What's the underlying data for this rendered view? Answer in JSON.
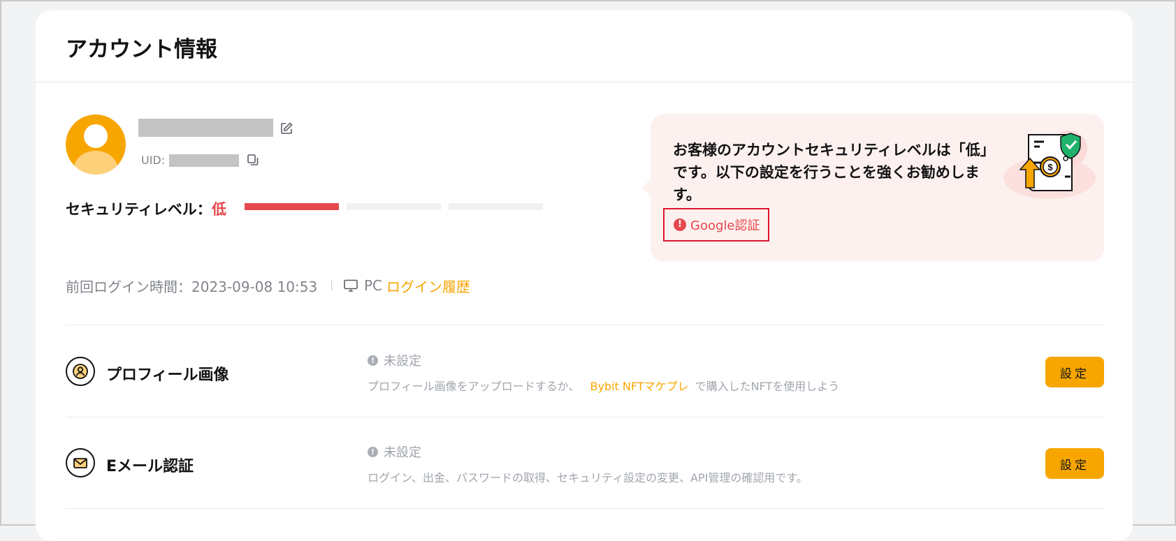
{
  "page": {
    "title": "アカウント情報"
  },
  "profile": {
    "uid_label": "UID:",
    "security_label": "セキュリティレベル：",
    "security_value": "低",
    "security_level": 1,
    "security_level_max": 3,
    "last_login_label": "前回ログイン時間：2023-09-08 10:53",
    "separator": "|",
    "device": "PC",
    "login_history_link": "ログイン履歴",
    "icons": {
      "edit": "edit-icon",
      "copy": "copy-icon",
      "device": "monitor-icon"
    }
  },
  "notice": {
    "message": "お客様のアカウントセキュリティレベルは「低」です。以下の設定を行うことを強くお勧めします。",
    "action_label": "Google認証",
    "action_icon": "alert-icon",
    "illustration": "security-shield-illustration"
  },
  "settings": [
    {
      "title": "プロフィール画像",
      "icon": "user-circle-icon",
      "status": "未設定",
      "desc_before": "プロフィール画像をアップロードするか、",
      "desc_link": "Bybit NFTマケプレ",
      "desc_after": "で購入したNFTを使用しよう",
      "button": "設定"
    },
    {
      "title": "Eメール認証",
      "icon": "envelope-icon",
      "status": "未設定",
      "desc_before": "ログイン、出金、パスワードの取得、セキュリティ設定の変更、API管理の確認用です。",
      "button": "設定"
    }
  ],
  "colors": {
    "accent": "#f7a600",
    "danger": "#e5484d",
    "notice_bg": "#fdf1ef",
    "text": "#121214",
    "muted": "#81858c"
  }
}
